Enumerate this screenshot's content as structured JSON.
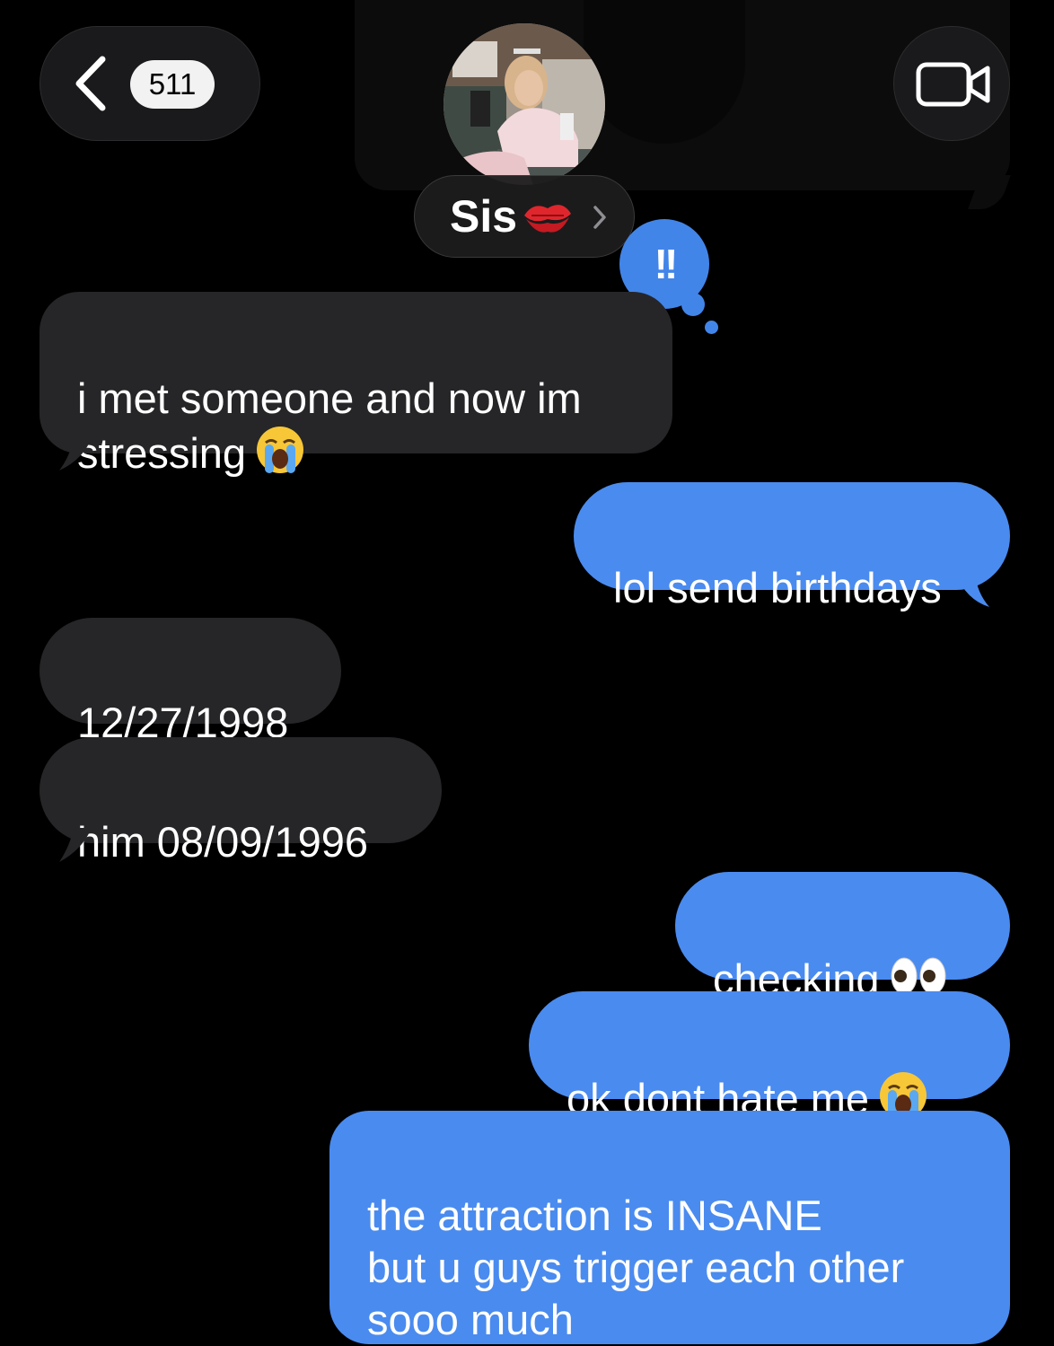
{
  "header": {
    "back_count": "511",
    "contact_name": "Sis",
    "contact_emoji": "kiss-mark-emoji",
    "avatar": "contact-photo",
    "video_icon": "video-camera-icon",
    "back_icon": "chevron-left-icon"
  },
  "tapback": {
    "label": "!!",
    "icon": "emphasis-tapback-icon"
  },
  "messages": [
    {
      "direction": "incoming",
      "text": "i met someone and now im\nstressing",
      "emoji": "loudly-crying-face-emoji"
    },
    {
      "direction": "outgoing",
      "text": "lol send birthdays"
    },
    {
      "direction": "incoming",
      "text": "12/27/1998"
    },
    {
      "direction": "incoming",
      "text": "him 08/09/1996"
    },
    {
      "direction": "outgoing",
      "text": "checking",
      "emoji": "eyes-emoji"
    },
    {
      "direction": "outgoing",
      "text": "ok dont hate me",
      "emoji": "loudly-crying-face-emoji"
    },
    {
      "direction": "outgoing",
      "text": "the attraction is INSANE\nbut u guys trigger each other\nsooo much"
    }
  ],
  "colors": {
    "background": "#000000",
    "incoming_bubble": "#262628",
    "outgoing_bubble": "#4a8bef",
    "tapback": "#4285e8"
  }
}
